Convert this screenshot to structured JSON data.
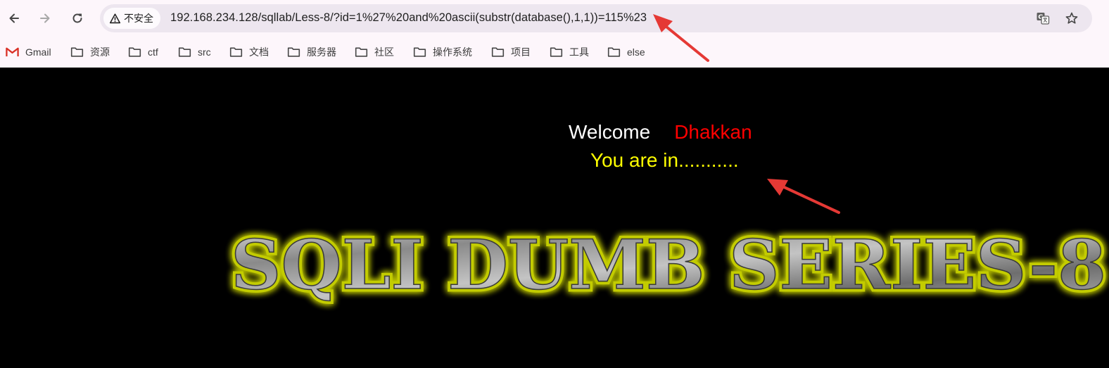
{
  "toolbar": {
    "back_icon": "arrow-left-icon",
    "forward_icon": "arrow-right-icon",
    "reload_icon": "reload-icon",
    "security_label": "不安全",
    "url": "192.168.234.128/sqllab/Less-8/?id=1%27%20and%20ascii(substr(database(),1,1))=115%23",
    "translate_icon": "translate-icon",
    "bookmark_star_icon": "star-icon"
  },
  "bookmarks": {
    "items": [
      {
        "label": "Gmail",
        "icon": "gmail-icon"
      },
      {
        "label": "资源",
        "icon": "folder-icon"
      },
      {
        "label": "ctf",
        "icon": "folder-icon"
      },
      {
        "label": "src",
        "icon": "folder-icon"
      },
      {
        "label": "文档",
        "icon": "folder-icon"
      },
      {
        "label": "服务器",
        "icon": "folder-icon"
      },
      {
        "label": "社区",
        "icon": "folder-icon"
      },
      {
        "label": "操作系统",
        "icon": "folder-icon"
      },
      {
        "label": "项目",
        "icon": "folder-icon"
      },
      {
        "label": "工具",
        "icon": "folder-icon"
      },
      {
        "label": "else",
        "icon": "folder-icon"
      }
    ]
  },
  "page": {
    "welcome_text": "Welcome",
    "user_name": "Dhakkan",
    "status_text": "You are in...........",
    "banner_text": "SQLI DUMB SERIES-8"
  },
  "colors": {
    "chrome_bg": "#fdf6fb",
    "omnibox_bg": "#ede6ef",
    "page_bg": "#000000",
    "welcome": "#ffffff",
    "name": "#ff0000",
    "status": "#ffff00",
    "banner_glow": "#e6f000",
    "annotation_arrow": "#e53935"
  }
}
